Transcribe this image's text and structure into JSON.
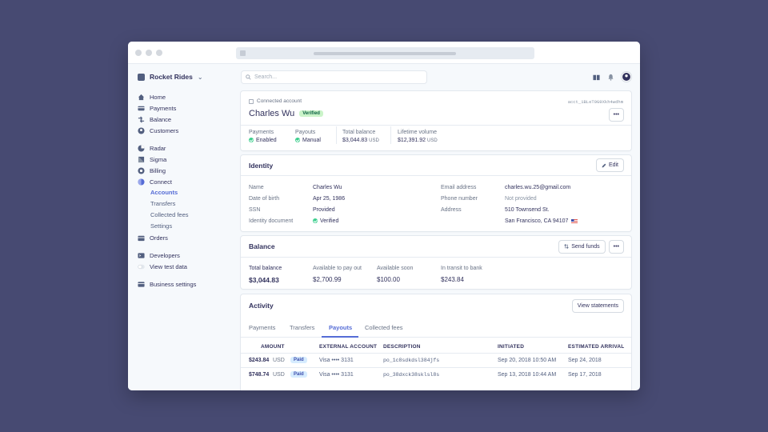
{
  "sidebar": {
    "brand": "Rocket Rides",
    "items": [
      {
        "label": "Home"
      },
      {
        "label": "Payments"
      },
      {
        "label": "Balance"
      },
      {
        "label": "Customers"
      },
      {
        "label": "Radar"
      },
      {
        "label": "Sigma"
      },
      {
        "label": "Billing"
      },
      {
        "label": "Connect"
      },
      {
        "label": "Orders"
      },
      {
        "label": "Developers"
      },
      {
        "label": "View test data"
      },
      {
        "label": "Business settings"
      }
    ],
    "connect_sub": [
      "Accounts",
      "Transfers",
      "Collected fees",
      "Settings"
    ]
  },
  "search": {
    "placeholder": "Search..."
  },
  "account": {
    "kicker": "Connected account",
    "id": "acct_1BLeT0G9Xkh4wdhm",
    "name": "Charles Wu",
    "verified": "Verified",
    "stats": [
      {
        "label": "Payments",
        "value": "Enabled"
      },
      {
        "label": "Payouts",
        "value": "Manual"
      },
      {
        "label": "Total balance",
        "value": "$3,044.83",
        "unit": "USD"
      },
      {
        "label": "Lifetime volume",
        "value": "$12,391.92",
        "unit": "USD"
      }
    ],
    "more": "•••"
  },
  "identity": {
    "title": "Identity",
    "edit": "Edit",
    "left": [
      {
        "label": "Name",
        "value": "Charles Wu"
      },
      {
        "label": "Date of birth",
        "value": "Apr 25, 1986"
      },
      {
        "label": "SSN",
        "value": "Provided"
      },
      {
        "label": "Identity document",
        "value": "Verified"
      }
    ],
    "right": [
      {
        "label": "Email address",
        "value": "charles.wu.25@gmail.com"
      },
      {
        "label": "Phone number",
        "value": "Not provided"
      },
      {
        "label": "Address",
        "value": "510 Townsend St."
      },
      {
        "label": "",
        "value": "San Francisco, CA 94107"
      }
    ]
  },
  "balance": {
    "title": "Balance",
    "send": "Send funds",
    "more": "•••",
    "items": [
      {
        "label": "Total balance",
        "value": "$3,044.83"
      },
      {
        "label": "Available to pay out",
        "value": "$2,700.99"
      },
      {
        "label": "Available soon",
        "value": "$100.00"
      },
      {
        "label": "In transit to bank",
        "value": "$243.84"
      }
    ]
  },
  "activity": {
    "title": "Activity",
    "view": "View statements",
    "tabs": [
      "Payments",
      "Transfers",
      "Payouts",
      "Collected fees"
    ],
    "columns": [
      "AMOUNT",
      "EXTERNAL ACCOUNT",
      "DESCRIPTION",
      "INITIATED",
      "ESTIMATED ARRIVAL"
    ],
    "rows": [
      {
        "amount": "$243.84",
        "currency": "USD",
        "status": "Paid",
        "account": "Visa •••• 3131",
        "description": "po_1c8sdkdsl384jfs",
        "initiated": "Sep 20, 2018 10:50 AM",
        "arrival": "Sep 24, 2018"
      },
      {
        "amount": "$748.74",
        "currency": "USD",
        "status": "Paid",
        "account": "Visa •••• 3131",
        "description": "po_38dxck38sklsl8s",
        "initiated": "Sep 13, 2018 10:44 AM",
        "arrival": "Sep 17, 2018"
      }
    ]
  },
  "colors": {
    "accent": "#556cd6",
    "background": "#474a72",
    "success": "#3ecf8e"
  }
}
